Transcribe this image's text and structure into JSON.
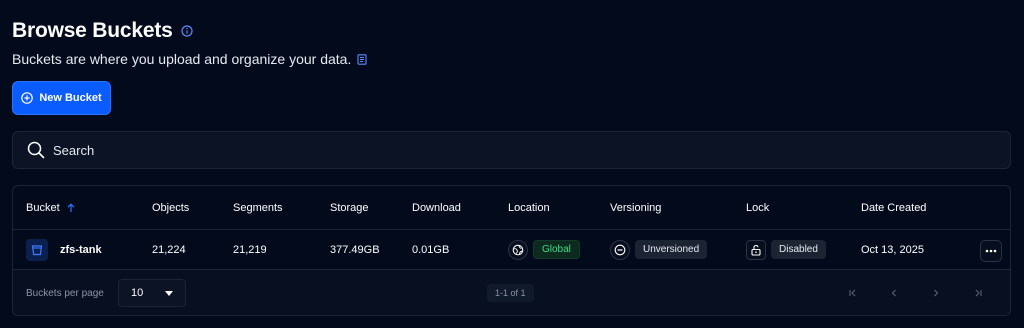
{
  "header": {
    "title": "Browse Buckets",
    "subtitle": "Buckets are where you upload and organize your data."
  },
  "actions": {
    "new_bucket_label": "New Bucket"
  },
  "search": {
    "placeholder": "Search"
  },
  "table": {
    "columns": [
      "Bucket",
      "Objects",
      "Segments",
      "Storage",
      "Download",
      "Location",
      "Versioning",
      "Lock",
      "Date Created"
    ],
    "sort_column": "Bucket",
    "sort_direction": "ascending",
    "rows": [
      {
        "bucket": "zfs-tank",
        "objects": "21,224",
        "segments": "21,219",
        "storage": "377.49GB",
        "download": "0.01GB",
        "location": "Global",
        "versioning": "Unversioned",
        "lock": "Disabled",
        "date_created": "Oct 13, 2025"
      }
    ]
  },
  "footer": {
    "per_page_label": "Buckets per page",
    "per_page_value": "10",
    "page_range": "1-1 of 1"
  },
  "colors": {
    "background": "#030a1c",
    "accent": "#0b5cff",
    "success": "#3ddc84"
  }
}
